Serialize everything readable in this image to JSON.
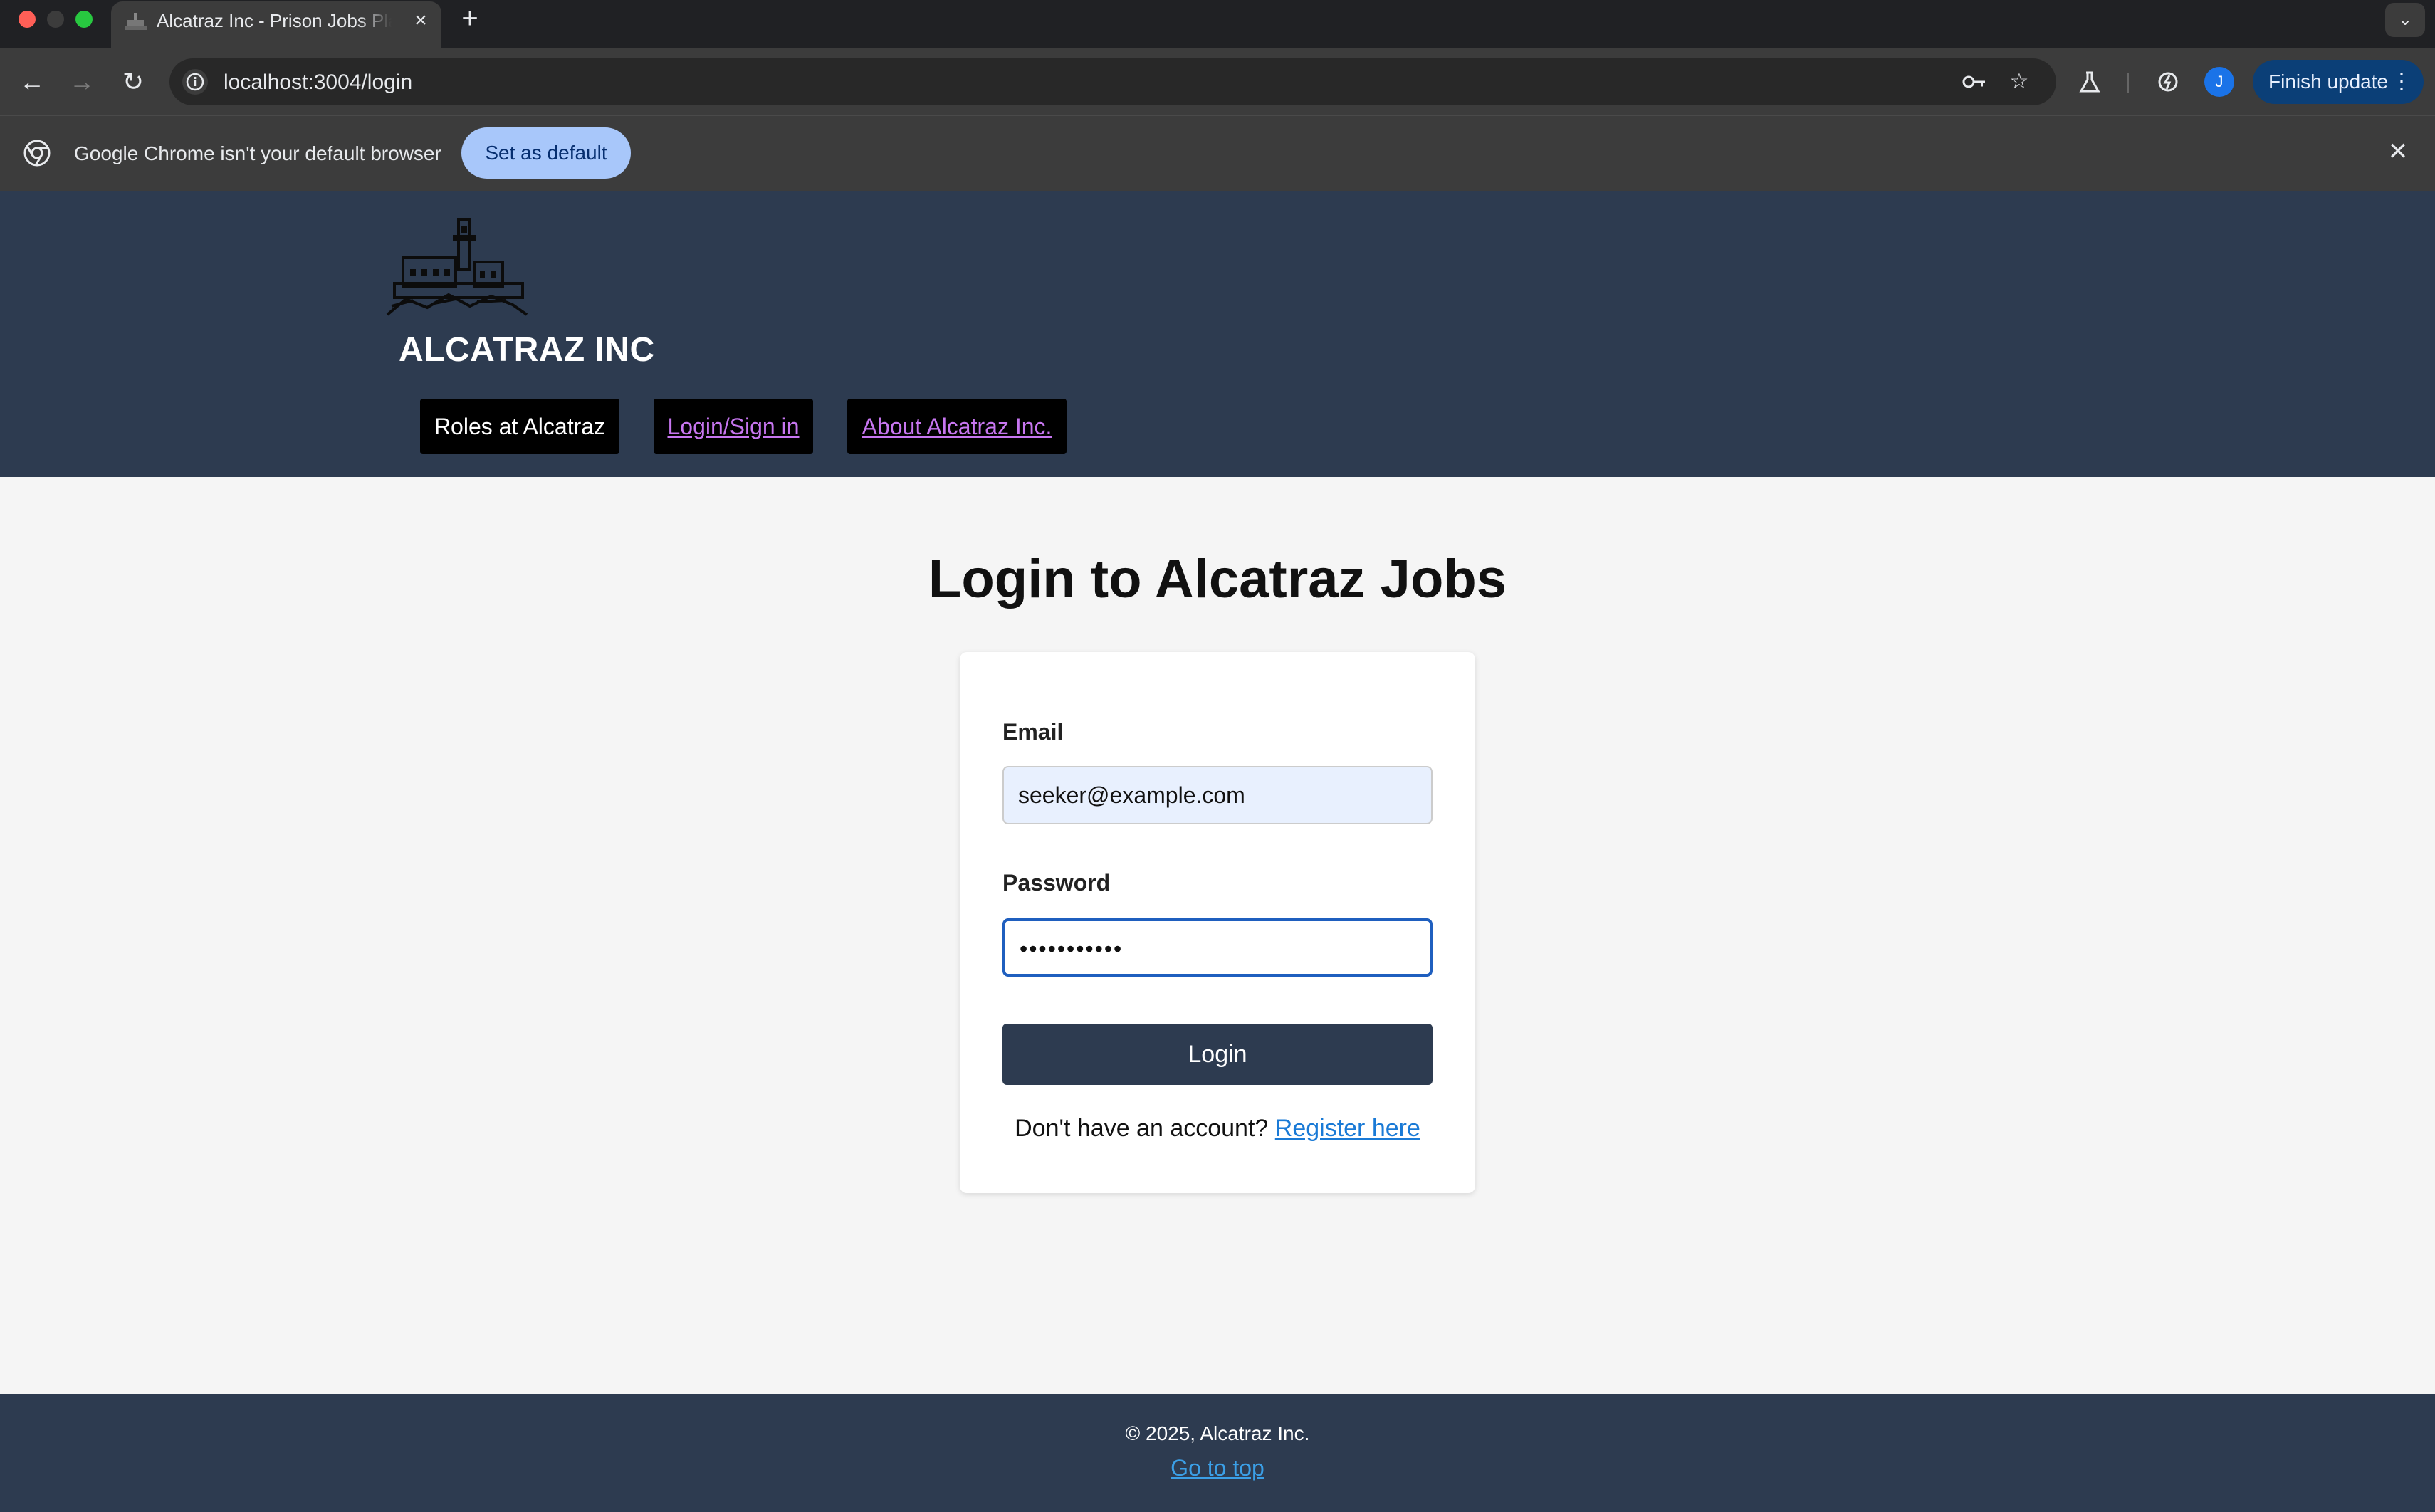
{
  "browser": {
    "tab_title": "Alcatraz Inc - Prison Jobs Platform",
    "tab_close": "×",
    "new_tab": "+",
    "url": "localhost:3004/login",
    "finish_update": "Finish update",
    "avatar_initial": "J",
    "infobar_text": "Google Chrome isn't your default browser",
    "set_default": "Set as default",
    "icons": [
      "back-icon",
      "forward-icon",
      "reload-icon",
      "site-info-icon",
      "password-key-icon",
      "bookmark-star-icon",
      "labs-flask-icon",
      "performance-icon",
      "more-vert-icon",
      "chrome-logo-icon",
      "close-icon",
      "tab-search-icon"
    ]
  },
  "header": {
    "brand": "ALCATRAZ INC",
    "nav": [
      {
        "label": "Roles at Alcatraz"
      },
      {
        "label": "Login/Sign in"
      },
      {
        "label": "About Alcatraz Inc."
      }
    ],
    "colors": {
      "background": "#2d3b50",
      "link": "#c776f0"
    }
  },
  "main": {
    "title": "Login to Alcatraz Jobs",
    "form": {
      "email_label": "Email",
      "email_value": "seeker@example.com",
      "password_label": "Password",
      "password_value": "•••••••••••",
      "submit_label": "Login",
      "register_prompt": "Don't have an account?",
      "register_link": "Register here"
    }
  },
  "footer": {
    "copyright": "© 2025, Alcatraz Inc.",
    "go_top": "Go to top"
  }
}
